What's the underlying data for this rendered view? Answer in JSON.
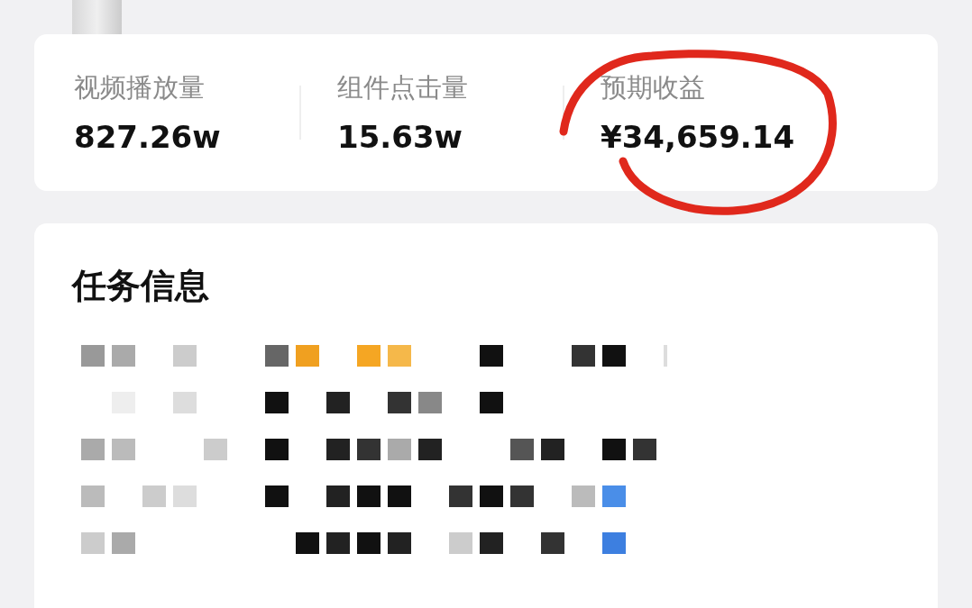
{
  "stats": [
    {
      "label": "视频播放量",
      "value": "827.26w"
    },
    {
      "label": "组件点击量",
      "value": "15.63w"
    },
    {
      "label": "预期收益",
      "value": "¥34,659.14"
    }
  ],
  "task_card": {
    "title": "任务信息"
  }
}
